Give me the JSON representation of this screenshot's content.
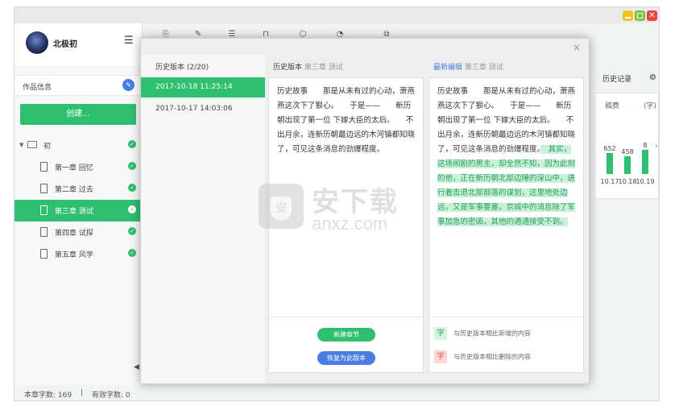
{
  "app": {
    "window_controls": {
      "min": "",
      "max": "",
      "close": "✕"
    },
    "user": {
      "name": "北极初"
    },
    "work_info": {
      "label": "作品信息"
    },
    "create_button": "创建...",
    "tree": {
      "root": {
        "label": "初"
      },
      "chapters": [
        {
          "label": "第一章 回忆",
          "active": false
        },
        {
          "label": "第二章 过去",
          "active": false
        },
        {
          "label": "第三章 测试",
          "active": true
        },
        {
          "label": "第四章 试探",
          "active": false
        },
        {
          "label": "第五章 风学",
          "active": false
        }
      ]
    },
    "status": {
      "chapter_chars": "本章字数: 169",
      "separator": "|",
      "valid_chars": "有效字数: 0"
    },
    "toolbar_icons": [
      "export-icon",
      "edit-icon",
      "list-icon",
      "lock-icon",
      "box-icon",
      "clock-icon",
      "copy-icon"
    ],
    "right_panel": {
      "tab": "历史记录",
      "stats_title": "稿费",
      "stats_unit": "(字)",
      "chart_data": {
        "type": "bar",
        "categories": [
          "10.17",
          "10.18",
          "10.19"
        ],
        "values": [
          652,
          458,
          8
        ],
        "data_labels": [
          "652",
          "458",
          "8"
        ],
        "next_arrow": "›"
      }
    }
  },
  "dialog": {
    "close": "×",
    "history_header": "历史版本 (2/20)",
    "history_items": [
      {
        "label": "2017-10-18 11:25:14",
        "active": true
      },
      {
        "label": "2017-10-17 14:03:06",
        "active": false
      }
    ],
    "left_col_head": {
      "main": "历史版本",
      "sub": "第三章 测试"
    },
    "right_col_head": {
      "main": "最新编辑",
      "sub": "第三章 测试"
    },
    "history_text": "历史故事　　那是从未有过的心动，萧燕燕这次下了狠心。　　于是——　　新历朝出现了第一位 下嫁大臣的太后。　　不出月余，连新历朝最边远的木河镇都知晓了，可见这条消息的劲爆程度。",
    "latest_text_plain": "历史故事　　那是从未有过的心动，萧燕燕这次下了狠心。　　于是——　　新历朝出现了第一位 下嫁大臣的太后。　　不出月余，连新历朝最边远的木河镇都知晓了，可见这条消息的劲爆程度。",
    "latest_text_added": "　其实，这场闹剧的男主，却全然不知，因为此刻的他，正在新历朝北部边陲的深山中，进行着击退北部部落的谋划，这里地处边远，又是军事要塞，京城中的消息除了军事加急的密函，其他的通通接受不到。",
    "new_chapter_button": "新建章节",
    "restore_button": "恢复为此版本",
    "legend": {
      "added_glyph": "字",
      "added_label": "与历史版本相比新增的内容",
      "deleted_glyph": "字",
      "deleted_label": "与历史版本相比删除的内容"
    }
  },
  "watermark": {
    "cn": "安下载",
    "en": "anxz.com",
    "shield": "安"
  }
}
